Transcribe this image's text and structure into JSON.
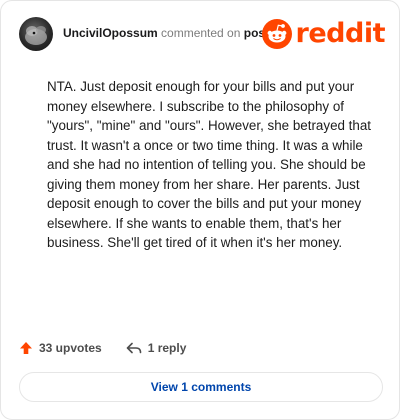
{
  "comment": {
    "username": "UncivilOpossum",
    "action_text": "commented on",
    "target_text": "post",
    "body": "NTA. Just deposit enough for your bills and put your money elsewhere. I subscribe to the philosophy of \"yours\", \"mine\" and \"ours\". However, she betrayed that trust. It wasn't a once or two time thing. It was a while and she had no intention of telling you. She should be giving them money from her share. Her parents. Just deposit enough to cover the bills and put your money elsewhere. If she wants to enable them, that's her business. She'll get tired of it when it's her money."
  },
  "logo": {
    "wordmark": "reddit",
    "color": "#ff4500"
  },
  "actions": {
    "upvotes_label": "33 upvotes",
    "replies_label": "1 reply",
    "upvote_icon": "upvote-arrow-icon",
    "reply_icon": "reply-arrow-icon"
  },
  "view_comments": {
    "label": "View 1 comments",
    "color": "#0045ac"
  }
}
